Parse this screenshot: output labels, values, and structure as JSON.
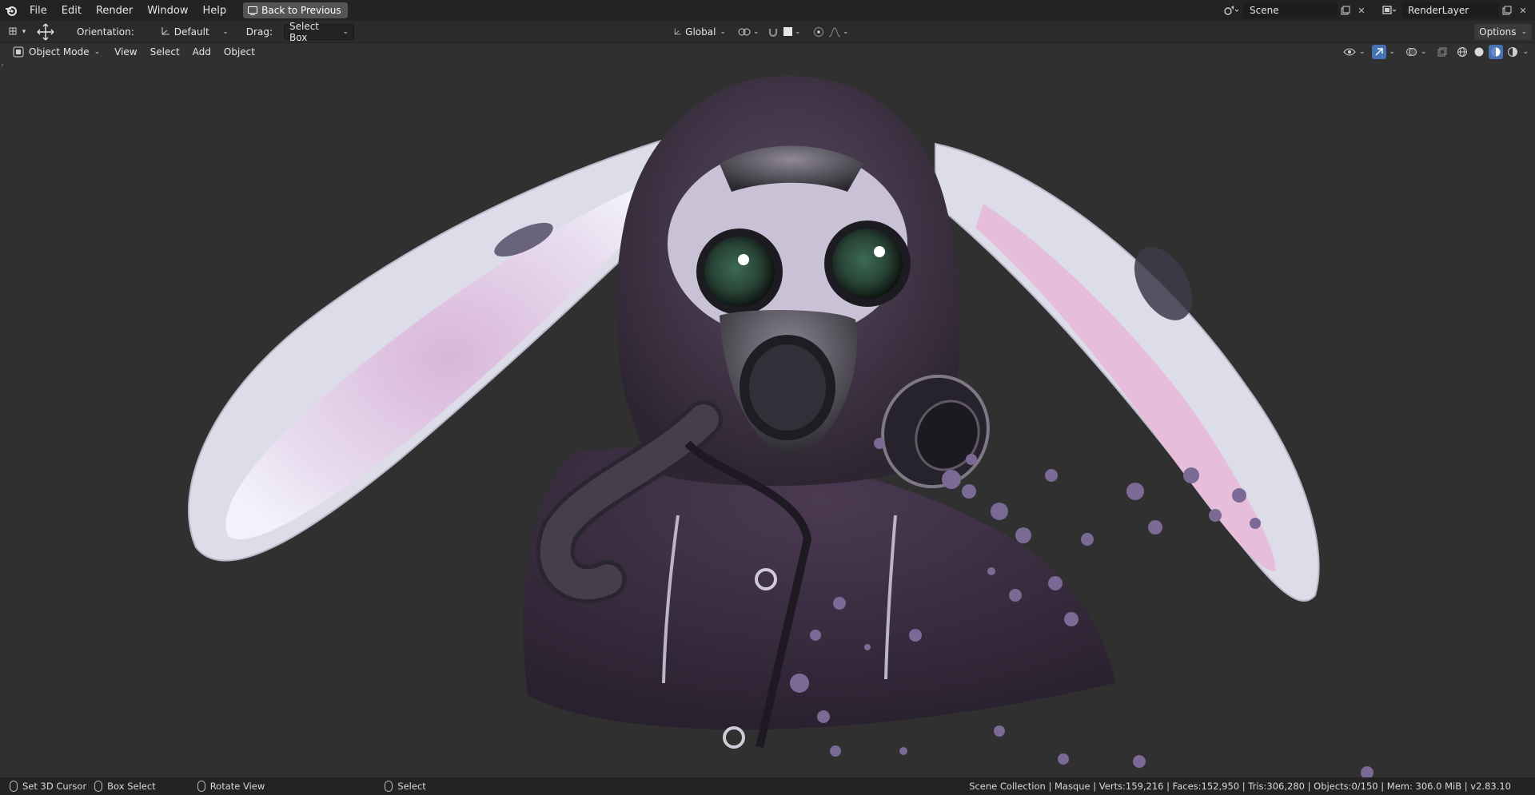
{
  "topbar": {
    "menus": [
      "File",
      "Edit",
      "Render",
      "Window",
      "Help"
    ],
    "back_label": "Back to Previous",
    "scene_name": "Scene",
    "view_layer": "RenderLayer"
  },
  "toolbar": {
    "orientation_label": "Orientation:",
    "orientation_value": "Default",
    "drag_label": "Drag:",
    "drag_value": "Select Box",
    "transform_orientation": "Global",
    "options_label": "Options"
  },
  "header3d": {
    "mode": "Object Mode",
    "menus": [
      "View",
      "Select",
      "Add",
      "Object"
    ]
  },
  "statusbar": {
    "hint1": "Set 3D Cursor",
    "hint2": "Box Select",
    "hint3": "Rotate View",
    "hint4": "Select",
    "stats": "Scene Collection | Masque | Verts:159,216 | Faces:152,950 | Tris:306,280 | Objects:0/150 | Mem: 306.0 MiB | v2.83.10"
  },
  "colors": {
    "accent": "#4772b3",
    "topbar_bg": "#232323",
    "viewport_bg": "#303030"
  }
}
